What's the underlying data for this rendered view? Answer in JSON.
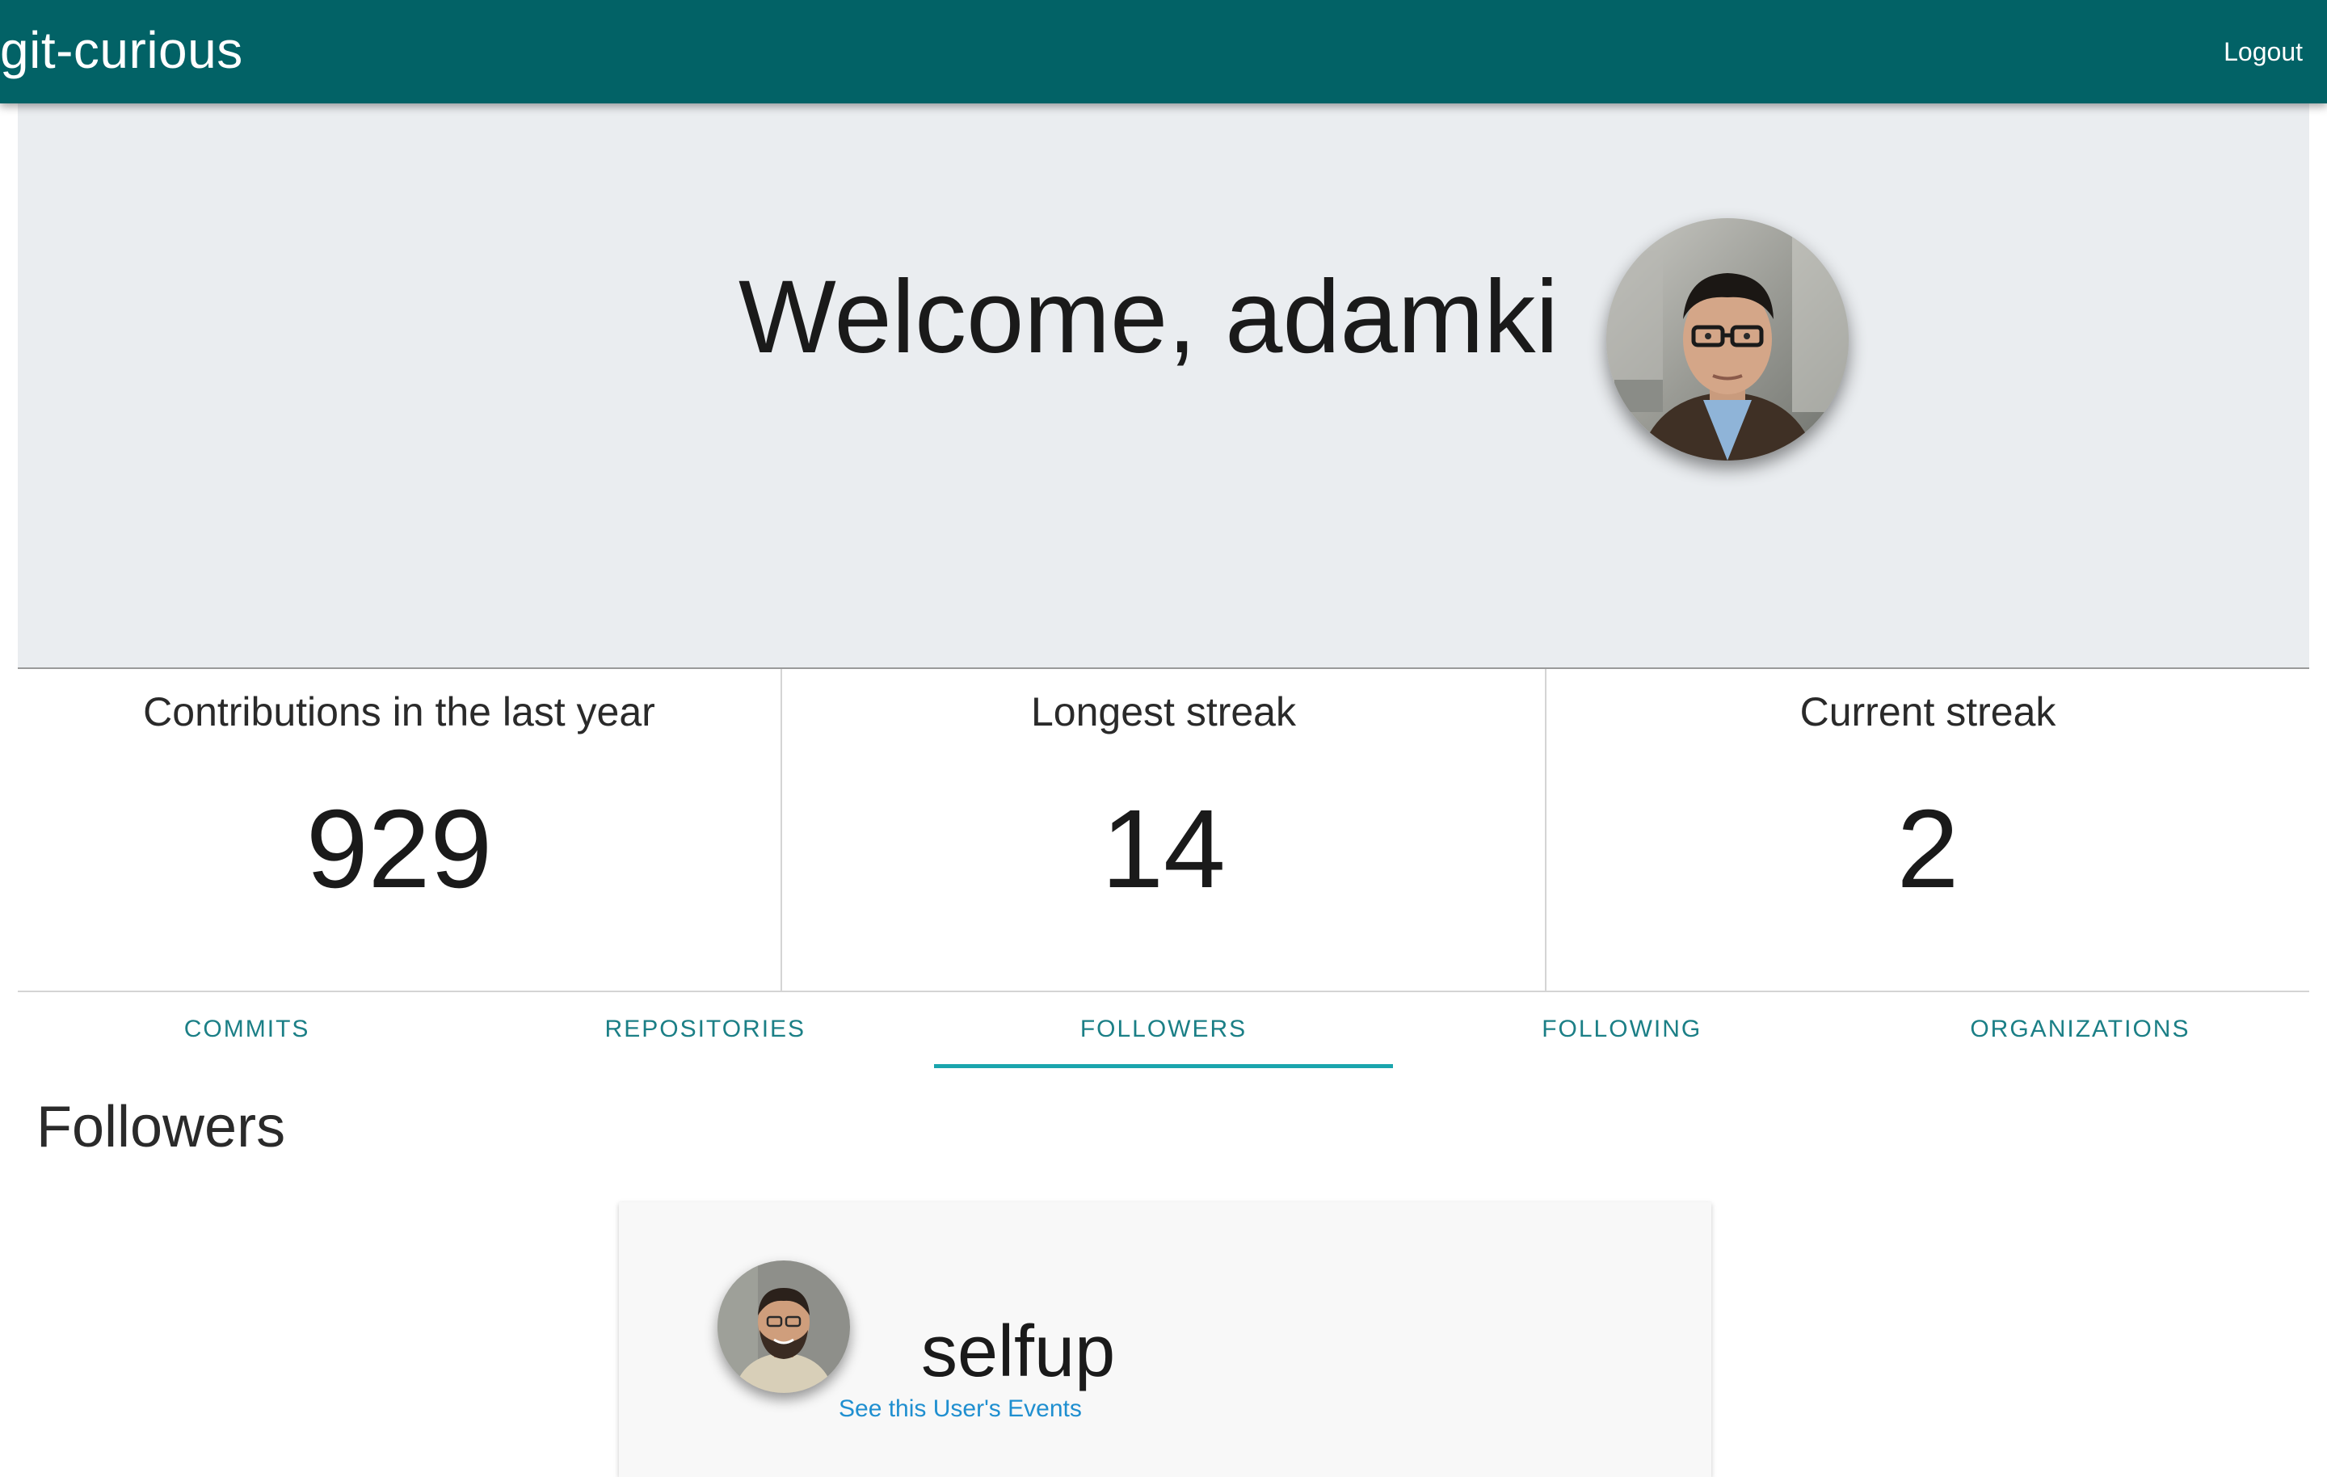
{
  "app": {
    "brand": "git-curious",
    "logout_label": "Logout"
  },
  "hero": {
    "welcome_text": "Welcome, adamki",
    "avatar_icon": "user-avatar-photo"
  },
  "stats": [
    {
      "label": "Contributions in the last year",
      "value": "929"
    },
    {
      "label": "Longest streak",
      "value": "14"
    },
    {
      "label": "Current streak",
      "value": "2"
    }
  ],
  "tabs": [
    {
      "label": "COMMITS",
      "active": false
    },
    {
      "label": "REPOSITORIES",
      "active": false
    },
    {
      "label": "FOLLOWERS",
      "active": true
    },
    {
      "label": "FOLLOWING",
      "active": false
    },
    {
      "label": "ORGANIZATIONS",
      "active": false
    }
  ],
  "followers": {
    "title": "Followers",
    "items": [
      {
        "username": "selfup",
        "link_label": "See this User's Events",
        "avatar_icon": "follower-avatar-photo"
      }
    ]
  },
  "colors": {
    "navbar": "#026266",
    "hero_bg": "#eaedf0",
    "tab_text": "#1b7f86",
    "tab_indicator": "#1aa5ad",
    "link": "#1f8fd0"
  }
}
